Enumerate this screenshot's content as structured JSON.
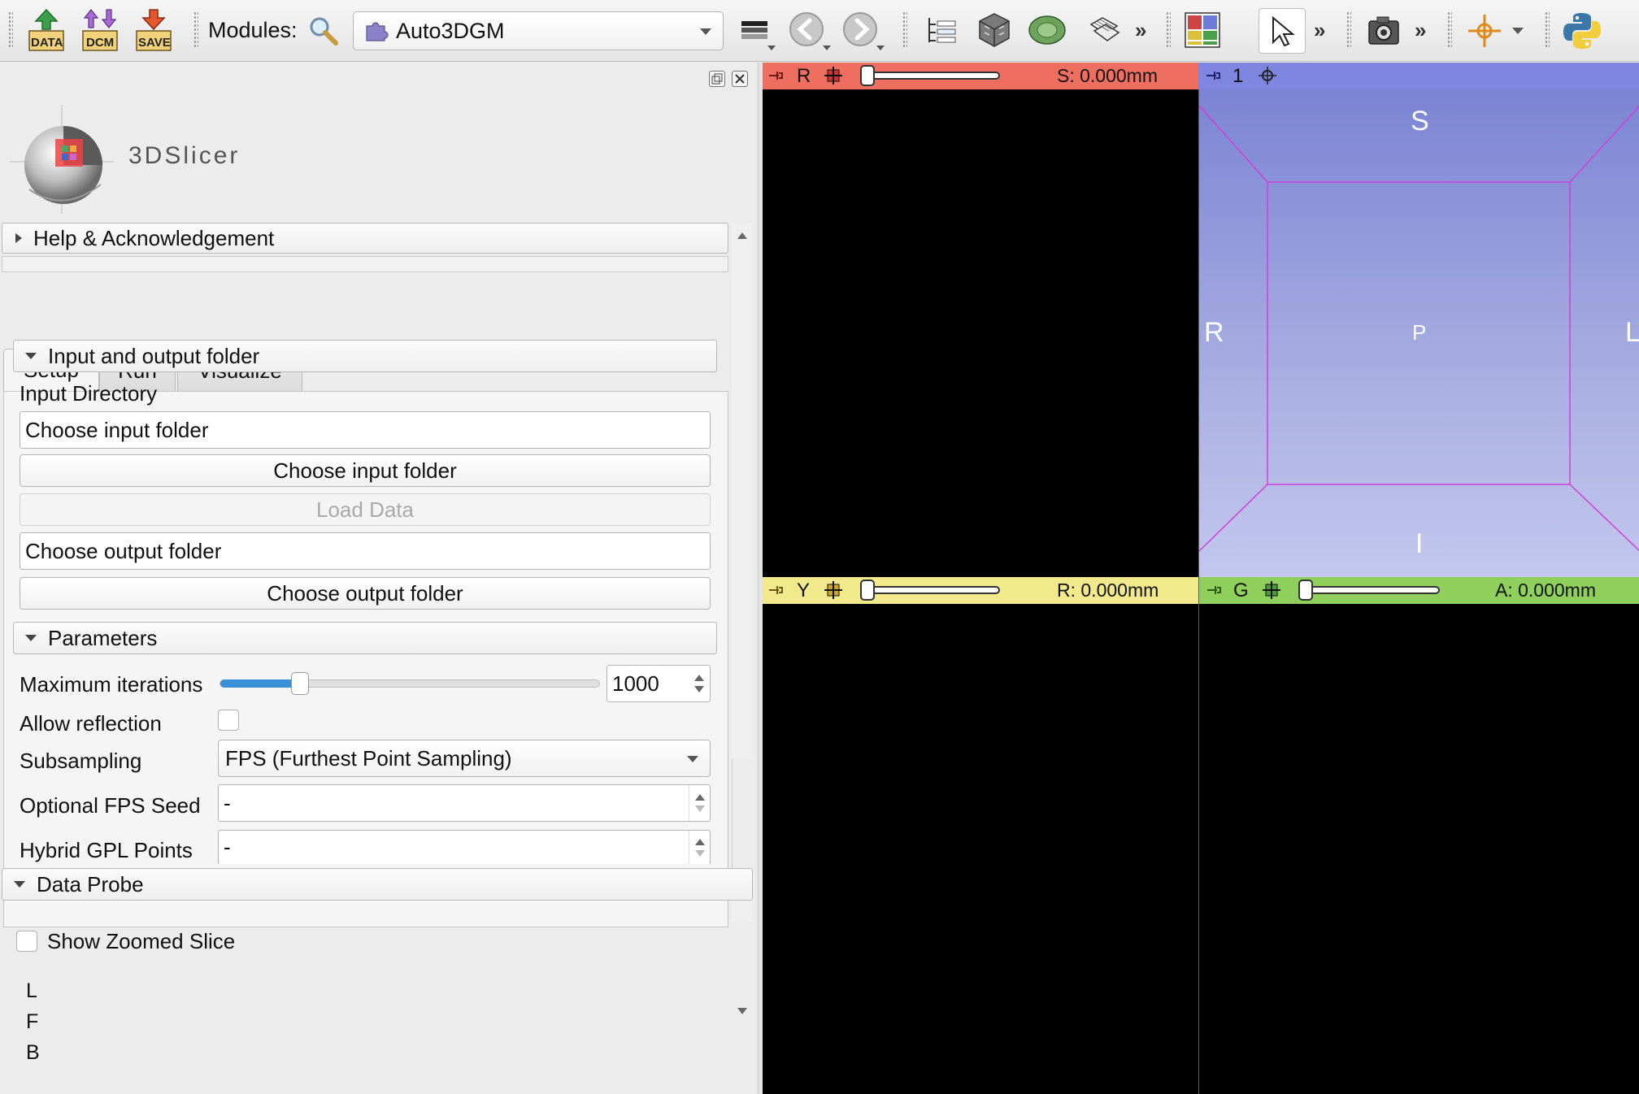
{
  "toolbar": {
    "data_label": "DATA",
    "dcm_label": "DCM",
    "save_label": "SAVE",
    "modules_label": "Modules:",
    "module_selected": "Auto3DGM",
    "more": "»"
  },
  "panel": {
    "logo_text": "3DSlicer",
    "help_label": "Help & Acknowledgement",
    "tabs": [
      "Setup",
      "Run",
      "Visualize"
    ],
    "io_section": "Input and output folder",
    "input_dir_label": "Input Directory",
    "input_field": "Choose input folder",
    "input_button": "Choose input folder",
    "load_button": "Load Data",
    "output_field": "Choose output folder",
    "output_button": "Choose output folder",
    "params_section": "Parameters",
    "max_iter_label": "Maximum iterations",
    "max_iter_value": "1000",
    "max_iter_fraction": 0.21,
    "allow_reflection_label": "Allow reflection",
    "subsampling_label": "Subsampling",
    "subsampling_value": "FPS (Furthest Point Sampling)",
    "fps_seed_label": "Optional FPS Seed",
    "fps_seed_value": "-",
    "hybrid_label": "Hybrid GPL Points",
    "hybrid_value": "-",
    "data_probe_label": "Data Probe",
    "show_zoomed_label": "Show Zoomed Slice",
    "probe_rows": [
      "L",
      "F",
      "B"
    ]
  },
  "viewers": {
    "red": {
      "letter": "R",
      "value": "S: 0.000mm",
      "color": "#f07060"
    },
    "threed": {
      "letter": "1",
      "color": "#7a84d8",
      "labels": {
        "top": "S",
        "left": "R",
        "center": "P",
        "right": "L",
        "bottom": "I"
      }
    },
    "yellow": {
      "letter": "Y",
      "value": "R: 0.000mm",
      "color": "#f2e88a"
    },
    "green": {
      "letter": "G",
      "value": "A: 0.000mm",
      "color": "#8ccf5a"
    }
  }
}
